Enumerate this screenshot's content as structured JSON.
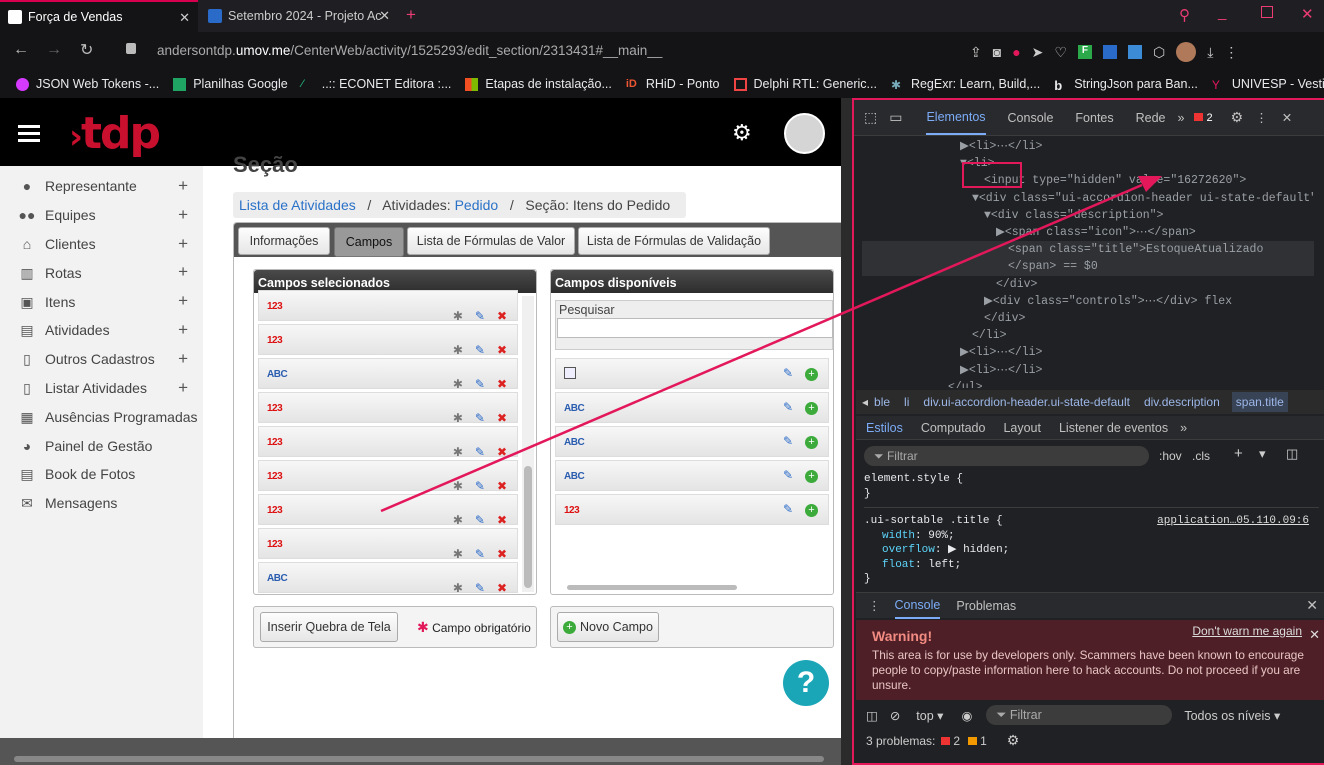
{
  "browser": {
    "tabs": [
      {
        "title": "Força de Vendas"
      },
      {
        "title": "Setembro 2024 - Projeto Ac"
      }
    ],
    "url_host": "andersontdp.",
    "url_domain": "umov.me",
    "url_path": "/CenterWeb/activity/1525293/edit_section/2313431#__main__",
    "bookmarks": [
      "JSON Web Tokens -...",
      "Planilhas Google",
      "..:: ECONET Editora :...",
      "Etapas de instalação...",
      "RHiD - Ponto",
      "Delphi RTL: Generic...",
      "RegExr: Learn, Build,...",
      "StringJson para Ban...",
      "UNIVESP - Vestibula..."
    ]
  },
  "app": {
    "logo": "tdp",
    "partial_heading": "Seção",
    "sidebar": [
      "Representante",
      "Equipes",
      "Clientes",
      "Rotas",
      "Itens",
      "Atividades",
      "Outros Cadastros",
      "Listar Atividades",
      "Ausências Programadas",
      "Painel de Gestão",
      "Book de Fotos",
      "Mensagens"
    ],
    "breadcrumb": {
      "link1": "Lista de Atividades",
      "sep": "/",
      "label2": "Atividades:",
      "link2": "Pedido",
      "label3": "Seção: Itens do Pedido"
    },
    "tabs": [
      "Informações",
      "Campos",
      "Lista de Fórmulas de Valor",
      "Lista de Fórmulas de Validação"
    ],
    "selected_panel": {
      "title": "Campos selecionados",
      "types": [
        "123",
        "123",
        "ABC",
        "123",
        "123",
        "123",
        "123",
        "123",
        "ABC"
      ]
    },
    "available_panel": {
      "title": "Campos disponíveis",
      "search_label": "Pesquisar",
      "search_value": "",
      "types": [
        "CAL",
        "ABC",
        "ABC",
        "ABC",
        "123"
      ]
    },
    "buttons": {
      "page_break": "Inserir Quebra de Tela",
      "required": "Campo obrigatório",
      "new_field": "Novo Campo"
    },
    "help": "?"
  },
  "devtools": {
    "tabs": [
      "Elementos",
      "Console",
      "Fontes",
      "Rede"
    ],
    "error_count": "2",
    "hidden_value": "16272620",
    "dom_lines": [
      {
        "indent": 9,
        "html": "▶<li>⋯</li>"
      },
      {
        "indent": 9,
        "html": "▼<li>"
      },
      {
        "indent": 11,
        "html": "<input type=\"hidden\" value=\"16272620\">"
      },
      {
        "indent": 10,
        "html": "▼<div class=\"ui-accordion-header ui-state-default\">"
      },
      {
        "indent": 11,
        "html": "▼<div class=\"description\">"
      },
      {
        "indent": 12,
        "html": "▶<span class=\"icon\">⋯</span>"
      },
      {
        "indent": 13,
        "html": "<span class=\"title\">EstoqueAtualizado"
      },
      {
        "indent": 13,
        "html": "</span> == $0"
      },
      {
        "indent": 12,
        "html": "</div>"
      },
      {
        "indent": 11,
        "html": "▶<div class=\"controls\">⋯</div> flex"
      },
      {
        "indent": 11,
        "html": "</div>"
      },
      {
        "indent": 10,
        "html": "</li>"
      },
      {
        "indent": 9,
        "html": "▶<li>⋯</li>"
      },
      {
        "indent": 9,
        "html": "▶<li>⋯</li>"
      },
      {
        "indent": 8,
        "html": "</ul>"
      }
    ],
    "crumbs": [
      "ble",
      "li",
      "div.ui-accordion-header.ui-state-default",
      "div.description",
      "span.title"
    ],
    "styles_tabs": [
      "Estilos",
      "Computado",
      "Layout",
      "Listener de eventos"
    ],
    "filter_placeholder": "Filtrar",
    "hov": ":hov",
    "cls": ".cls",
    "css_rule1": "element.style {",
    "css_close": "}",
    "css_selector": ".ui-sortable .title {",
    "css_source": "application…05.110.09:6",
    "css_props": [
      {
        "p": "width",
        "v": "90%;"
      },
      {
        "p": "overflow",
        "v": "▶ hidden;"
      },
      {
        "p": "float",
        "v": "left;"
      }
    ],
    "drawer_tabs": [
      "Console",
      "Problemas"
    ],
    "warning_title": "Warning!",
    "warning_dismiss": "Don't warn me again",
    "warning_text": "This area is for use by developers only. Scammers have been known to encourage people to copy/paste information here to hack accounts. Do not proceed if you are unsure.",
    "context": "top",
    "levels": "Todos os níveis",
    "problems_label": "3 problemas:",
    "problems_err": "2",
    "problems_warn": "1"
  },
  "colors": {
    "accent": "#e2185b",
    "brand": "#c8102e"
  }
}
